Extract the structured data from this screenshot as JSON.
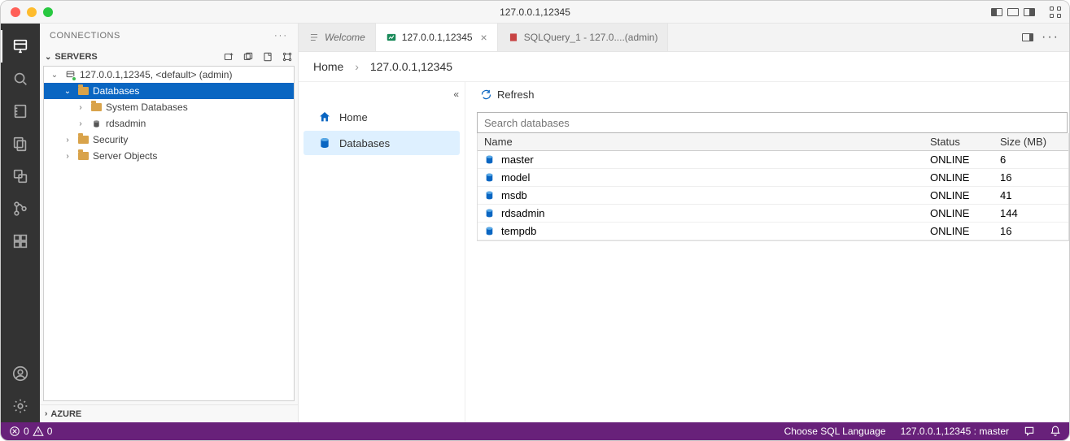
{
  "window_title": "127.0.0.1,12345",
  "sidebar": {
    "title": "CONNECTIONS",
    "servers_label": "SERVERS",
    "azure_label": "AZURE",
    "server_node": "127.0.0.1,12345, <default> (admin)",
    "databases_label": "Databases",
    "system_db_label": "System Databases",
    "rdsadmin_label": "rdsadmin",
    "security_label": "Security",
    "server_objects_label": "Server Objects"
  },
  "tabs": {
    "welcome": "Welcome",
    "dashboard": "127.0.0.1,12345",
    "query": "SQLQuery_1 - 127.0....(admin)"
  },
  "breadcrumb": {
    "home": "Home",
    "current": "127.0.0.1,12345"
  },
  "nav": {
    "home": "Home",
    "databases": "Databases"
  },
  "refresh_label": "Refresh",
  "search_placeholder": "Search databases",
  "table": {
    "col_name": "Name",
    "col_status": "Status",
    "col_size": "Size (MB)",
    "rows": [
      {
        "name": "master",
        "status": "ONLINE",
        "size": "6"
      },
      {
        "name": "model",
        "status": "ONLINE",
        "size": "16"
      },
      {
        "name": "msdb",
        "status": "ONLINE",
        "size": "41"
      },
      {
        "name": "rdsadmin",
        "status": "ONLINE",
        "size": "144"
      },
      {
        "name": "tempdb",
        "status": "ONLINE",
        "size": "16"
      }
    ]
  },
  "statusbar": {
    "errors": "0",
    "warnings": "0",
    "lang": "Choose SQL Language",
    "conn": "127.0.0.1,12345 : master"
  }
}
